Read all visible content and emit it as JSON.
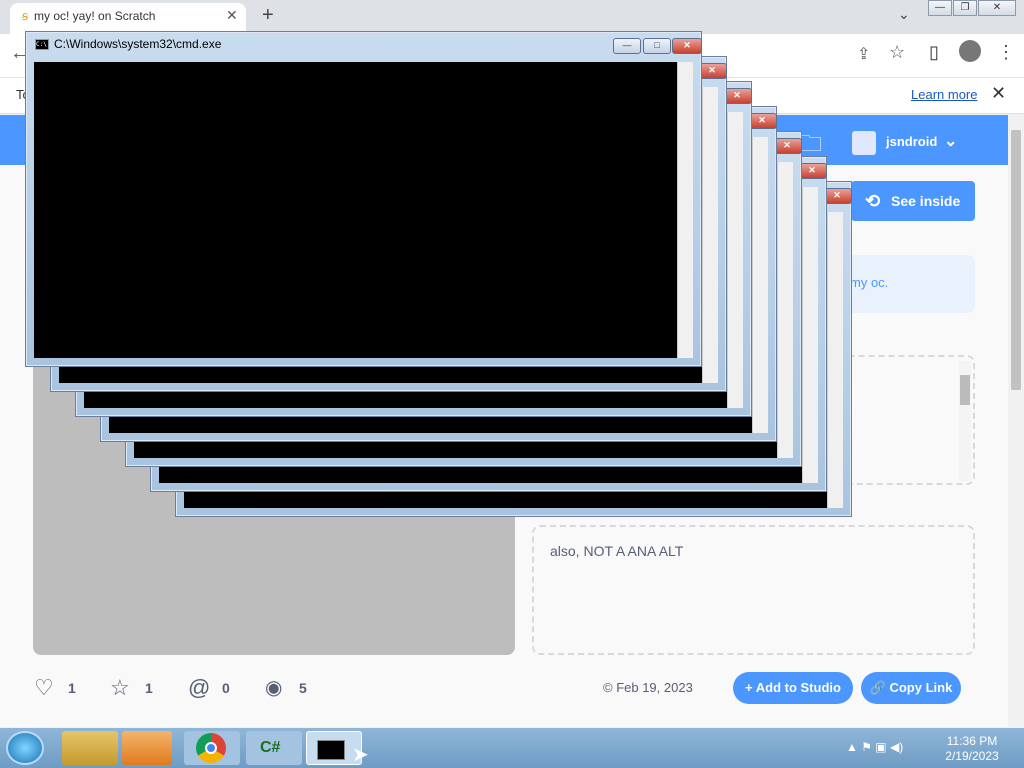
{
  "browser": {
    "tab_title": "my oc! yay! on Scratch",
    "tab_close": "✕",
    "new_tab": "+",
    "win_min": "—",
    "win_max": "❐",
    "win_close": "✕",
    "back": "←",
    "infobar_prefix": "To",
    "learn_more": "Learn more",
    "infobar_close": "✕",
    "toolbar_icons": {
      "share": "⇪",
      "star": "☆",
      "sidebar": "▯",
      "profile": "●",
      "menu": "⋮"
    },
    "dropdown": "⌄"
  },
  "scratch": {
    "username": "jsndroid",
    "username_caret": "⌄",
    "see_inside": "See inside",
    "instructions_text": "my oc.",
    "notes_text": "also, NOT A ANA ALT",
    "stats": {
      "loves": "1",
      "favorites": "1",
      "remixes": "0",
      "views": "5"
    },
    "date": "© Feb 19, 2023",
    "add_to_studio": "+ Add to Studio",
    "copy_link": "🔗 Copy Link",
    "folder_icon": "🗀",
    "refresh_icon": "⟲"
  },
  "cmd": {
    "title": "C:\\Windows\\system32\\cmd.exe",
    "min": "—",
    "max": "□",
    "close": "✕",
    "icon": "C:\\"
  },
  "taskbar": {
    "time": "11:36 PM",
    "date": "2/19/2023",
    "csharp": "C#",
    "tray": "▲ ⚑ ▣ ◀)"
  }
}
